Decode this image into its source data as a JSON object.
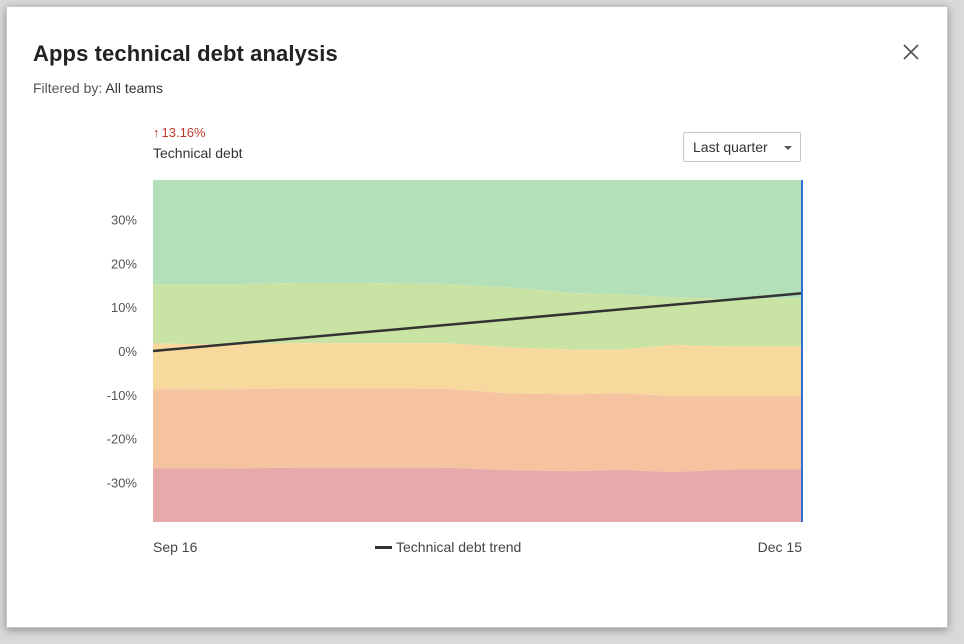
{
  "dialog": {
    "title": "Apps technical debt analysis",
    "filter_label": "Filtered by:",
    "filter_value": "All teams",
    "close_icon": "close-icon"
  },
  "summary": {
    "change": "13.16%",
    "change_direction": "up",
    "change_color": "#c0392b",
    "metric_label": "Technical debt"
  },
  "period_select": {
    "value": "Last quarter"
  },
  "legend": {
    "trend_label": "Technical debt trend"
  },
  "chart_data": {
    "type": "area",
    "x_labels": [
      "Sep 16",
      "Dec 15"
    ],
    "y_ticks": [
      "30%",
      "20%",
      "10%",
      "0%",
      "-10%",
      "-20%",
      "-30%"
    ],
    "y_tick_values": [
      30,
      20,
      10,
      0,
      -10,
      -20,
      -30
    ],
    "ylim": [
      -39,
      39
    ],
    "bands": [
      {
        "color": "#b3dfb9",
        "lower": [
          15.2,
          15.2,
          15.5,
          15.5,
          15.3,
          14.5,
          13.2,
          13.0,
          12.2,
          11.9,
          12.1
        ]
      },
      {
        "color": "#c9e3a4",
        "lower": [
          1.7,
          1.5,
          1.8,
          1.8,
          1.8,
          0.8,
          0.3,
          0.3,
          1.4,
          1.0,
          1.0
        ]
      },
      {
        "color": "#f7d99d",
        "lower": [
          -8.7,
          -8.8,
          -8.5,
          -8.5,
          -8.6,
          -9.7,
          -9.9,
          -9.6,
          -10.3,
          -10.3,
          -10.3
        ]
      },
      {
        "color": "#f6c3a0",
        "lower": [
          -26.8,
          -26.8,
          -26.6,
          -26.6,
          -26.6,
          -27.2,
          -27.4,
          -27.1,
          -27.6,
          -27.0,
          -27.0
        ]
      },
      {
        "color": "#e8a9ab",
        "lower": [
          -39,
          -39,
          -39,
          -39,
          -39,
          -39,
          -39,
          -39,
          -39,
          -39,
          -39
        ]
      }
    ],
    "band_x": [
      0,
      0.1,
      0.22,
      0.33,
      0.45,
      0.55,
      0.65,
      0.72,
      0.8,
      0.9,
      1.0
    ],
    "trend": {
      "start": 0.0,
      "end": 13.16,
      "color": "#333333"
    },
    "marker_color": "#2f6fd6",
    "grid": false
  }
}
